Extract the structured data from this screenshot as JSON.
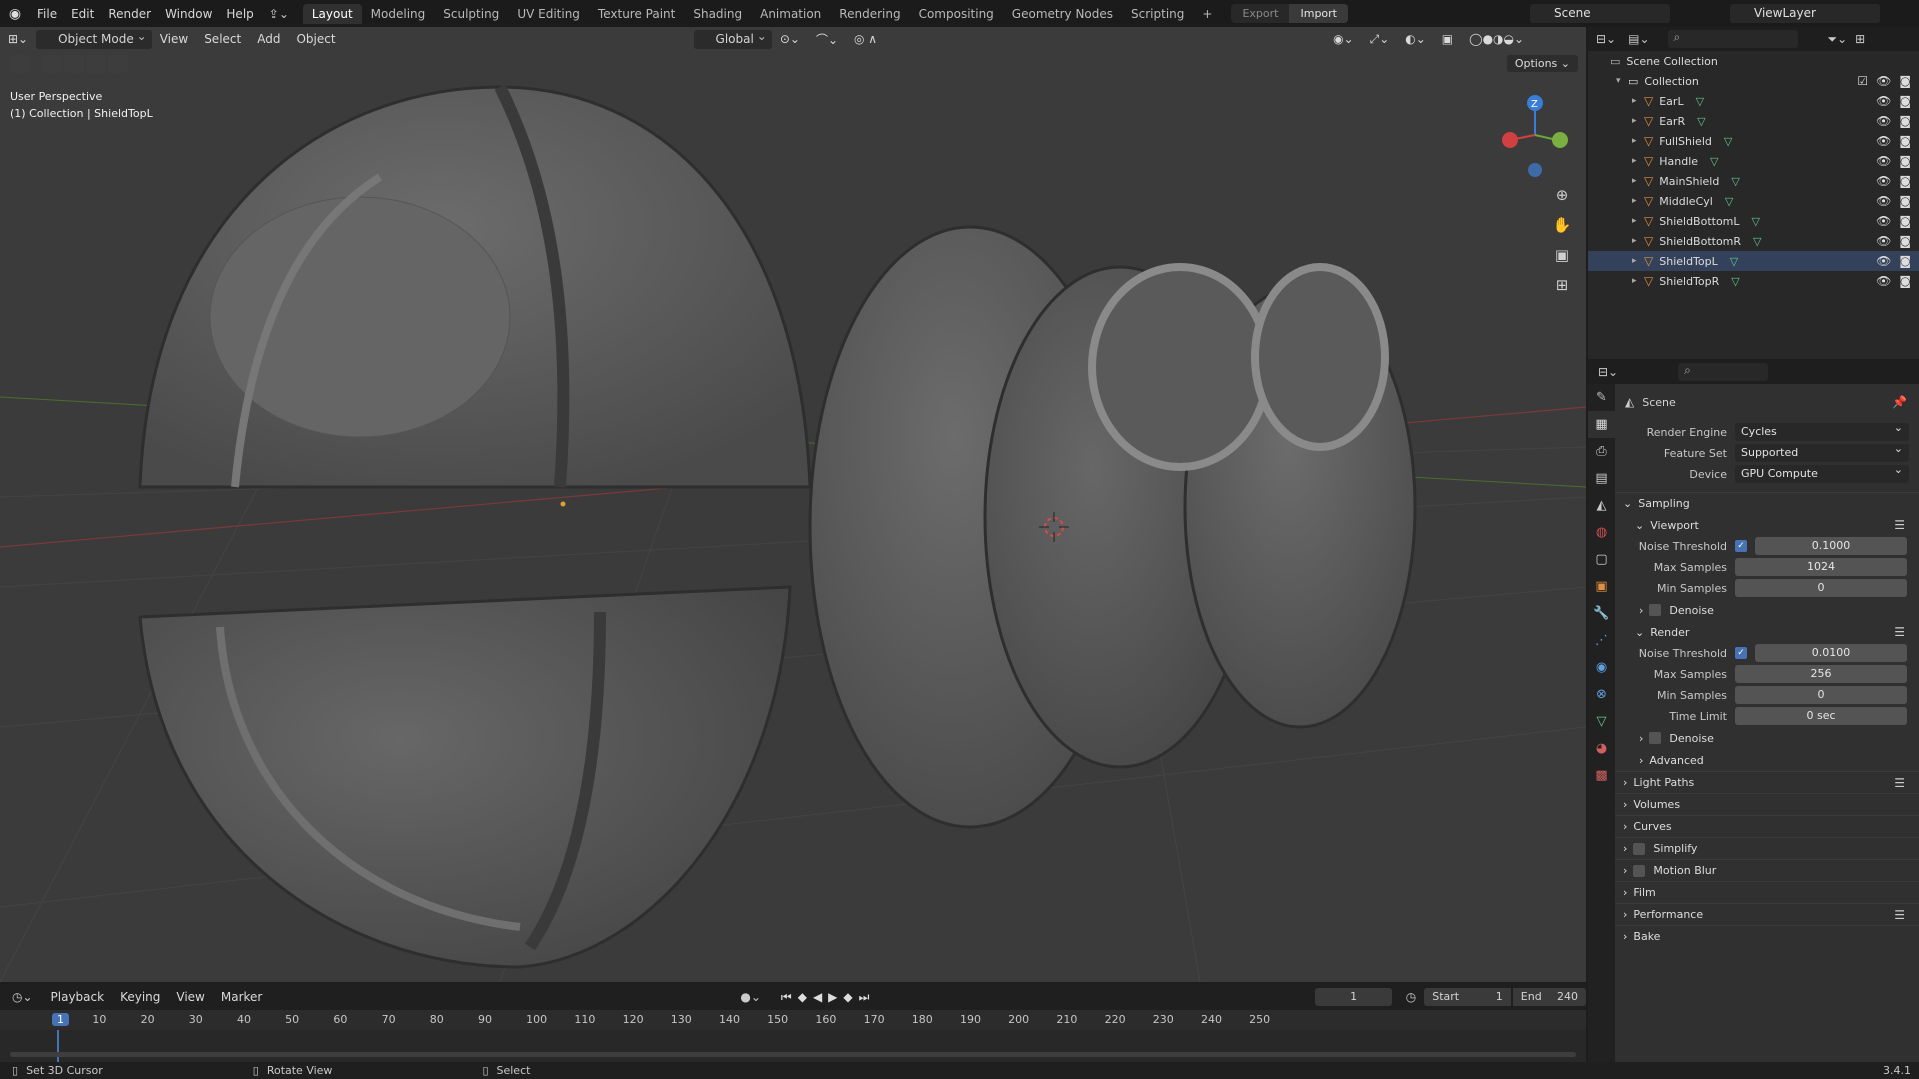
{
  "topbar": {
    "menu": [
      "File",
      "Edit",
      "Render",
      "Window",
      "Help"
    ],
    "workspaces": [
      "Layout",
      "Modeling",
      "Sculpting",
      "UV Editing",
      "Texture Paint",
      "Shading",
      "Animation",
      "Rendering",
      "Compositing",
      "Geometry Nodes",
      "Scripting"
    ],
    "active_workspace": "Layout",
    "export_label": "Export",
    "import_label": "Import",
    "scene_name": "Scene",
    "viewlayer_name": "ViewLayer"
  },
  "viewport": {
    "mode": "Object Mode",
    "menus": [
      "View",
      "Select",
      "Add",
      "Object"
    ],
    "transform_orientation": "Global",
    "options_label": "Options",
    "perspective_label": "User Perspective",
    "context_label": "(1) Collection | ShieldTopL",
    "gizmo": {
      "z": "Z"
    }
  },
  "outliner": {
    "root": "Scene Collection",
    "collection": "Collection",
    "objects": [
      "EarL",
      "EarR",
      "FullShield",
      "Handle",
      "MainShield",
      "MiddleCyl",
      "ShieldBottomL",
      "ShieldBottomR",
      "ShieldTopL",
      "ShieldTopR"
    ]
  },
  "properties": {
    "title": "Scene",
    "render_engine_label": "Render Engine",
    "render_engine": "Cycles",
    "feature_set_label": "Feature Set",
    "feature_set": "Supported",
    "device_label": "Device",
    "device": "GPU Compute",
    "sampling": "Sampling",
    "viewport_section": "Viewport",
    "vp_noise_label": "Noise Threshold",
    "vp_noise": "0.1000",
    "vp_max_label": "Max Samples",
    "vp_max": "1024",
    "vp_min_label": "Min Samples",
    "vp_min": "0",
    "denoise": "Denoise",
    "render_section": "Render",
    "r_noise": "0.0100",
    "r_max": "256",
    "r_min": "0",
    "time_limit_label": "Time Limit",
    "time_limit": "0 sec",
    "advanced": "Advanced",
    "panels": [
      "Light Paths",
      "Volumes",
      "Curves",
      "Simplify",
      "Motion Blur",
      "Film",
      "Performance",
      "Bake"
    ]
  },
  "timeline": {
    "menus": [
      "Playback",
      "Keying",
      "View",
      "Marker"
    ],
    "current_frame": "1",
    "start_label": "Start",
    "start": "1",
    "end_label": "End",
    "end": "240",
    "ruler": [
      "1",
      "10",
      "20",
      "30",
      "40",
      "50",
      "60",
      "70",
      "80",
      "90",
      "100",
      "110",
      "120",
      "130",
      "140",
      "150",
      "160",
      "170",
      "180",
      "190",
      "200",
      "210",
      "220",
      "230",
      "240",
      "250"
    ]
  },
  "statusbar": {
    "hints": [
      "Set 3D Cursor",
      "Rotate View",
      "Select"
    ],
    "version": "3.4.1"
  }
}
